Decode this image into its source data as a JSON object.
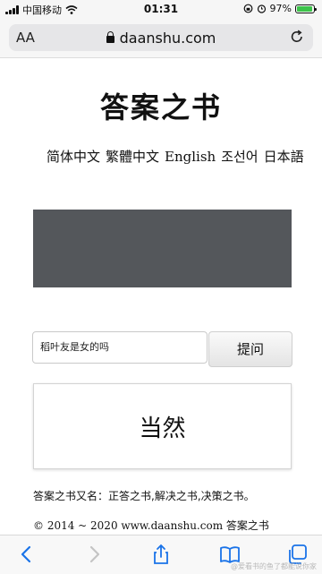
{
  "status_bar": {
    "carrier": "中国移动",
    "time": "01:31",
    "battery": "97%",
    "battery_level": 0.97
  },
  "address_bar": {
    "text_size_label": "AA",
    "url": "daanshu.com"
  },
  "page": {
    "title": "答案之书",
    "languages": [
      "简体中文",
      "繁體中文",
      "English",
      "조선어",
      "日本語"
    ],
    "question_value": "稻叶友是女的吗",
    "ask_button": "提问",
    "answer": "当然",
    "aliases": "答案之书又名：正答之书,解决之书,决策之书。",
    "copyright": "© 2014 ~ 2020 www.daanshu.com 答案之书"
  },
  "toolbar": {
    "icons": [
      "back-icon",
      "forward-icon",
      "share-icon",
      "bookmarks-icon",
      "tabs-icon"
    ]
  },
  "watermark": "@爱看书的鱼了都能说你家"
}
